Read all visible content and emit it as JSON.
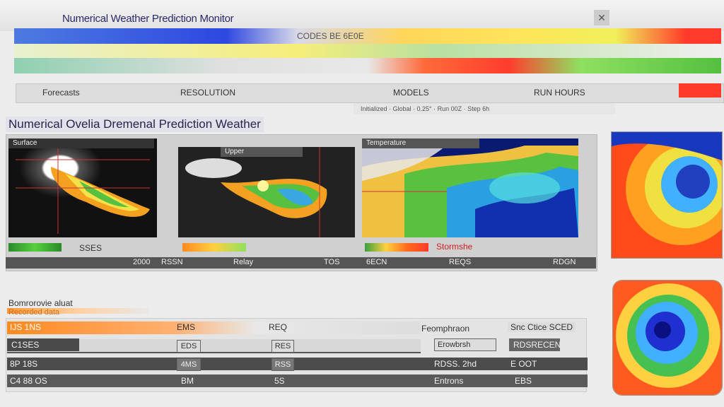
{
  "window": {
    "title": "Numerical Weather Prediction Monitor",
    "close_icon": "close-icon"
  },
  "strips": {
    "strip1_text": "CODES BE 6E0E"
  },
  "nav": {
    "items": [
      "Forecasts",
      "RESOLUTION",
      "MODELS",
      "RUN HOURS"
    ],
    "sub_text": "Initialized · Global · 0.25° · Run 00Z · Step 6h"
  },
  "page": {
    "title": "Numerical Ovelia Dremenal Prediction Weather"
  },
  "panel": {
    "map_labels": [
      "Surface",
      "Upper",
      "Temperature"
    ],
    "legend_labels": [
      "SSES",
      "Stormshe"
    ],
    "axis_labels": [
      "2000",
      "RSSN",
      "Relay",
      "TOS",
      "6ECN",
      "REQS",
      "RDGN"
    ]
  },
  "section": {
    "title": "Bomrorovie aluat",
    "subtitle": "Recorded data"
  },
  "table": {
    "rows": [
      {
        "c1": "IJS 1NS",
        "c2": "EMS",
        "c3": "REQ",
        "c4": "Feomphraon",
        "c5": "Snc Ctice SCED"
      },
      {
        "c1": "C1SES",
        "c2": "EDS",
        "c3": "RES",
        "c4": "Erowbrsh",
        "c5": "RDSRECEN"
      },
      {
        "c1": "8P 18S",
        "c2": "4MS",
        "c3": "RSS",
        "c4": "RDSS. 2hd",
        "c5": "E OOT"
      },
      {
        "c1": "C4 88 OS",
        "c2": "BM",
        "c3": "5S",
        "c4": "Entrons",
        "c5": "EBS"
      }
    ]
  },
  "colors": {
    "accent_red": "#ff3a2a",
    "accent_orange": "#ff9a3a",
    "title_blue": "#25254f"
  }
}
